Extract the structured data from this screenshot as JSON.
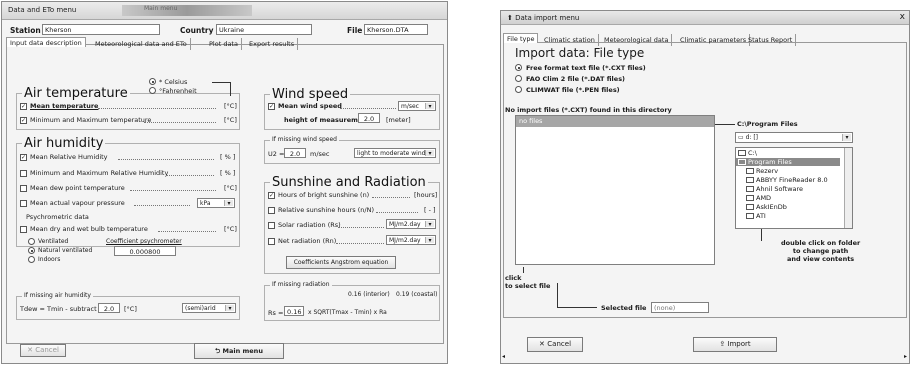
{
  "left": {
    "title": "Data and ETo menu",
    "title_blurred": "Main menu",
    "station_label": "Station",
    "station_value": "Kherson",
    "country_label": "Country",
    "country_value": "Ukraine",
    "file_label": "File",
    "file_value": "Kherson.DTA",
    "tabs": [
      "Input data description",
      "Meteorological data and ETo",
      "Plot data",
      "Export results"
    ],
    "air_temp": {
      "title": "Air temperature",
      "celsius": "* Celsius",
      "fahrenheit": "°Fahrenheit",
      "mean": "Mean temperature",
      "mean_unit": "[°C]",
      "minmax": "Minimum and Maximum temperature",
      "minmax_unit": "[°C]"
    },
    "humidity": {
      "title": "Air humidity",
      "mean_rh": "Mean Relative Humidity",
      "mean_rh_unit": "[ % ]",
      "minmax_rh": "Minimum and Maximum Relative Humidity",
      "minmax_rh_unit": "[ % ]",
      "dew": "Mean dew point temperature",
      "dew_unit": "[°C]",
      "vapour": "Mean actual vapour pressure",
      "vapour_unit": "kPa",
      "psychro_title": "Psychrometric data",
      "drywet": "Mean dry and wet bulb temperature",
      "drywet_unit": "[°C]",
      "ventilated": "Ventilated",
      "natural": "Natural ventilated",
      "indoors": "Indoors",
      "coef_label": "Coefficient psychrometer",
      "coef_value": "0.000800",
      "missing_title": "If missing air humidity",
      "tdew_label": "Tdew = Tmin - subtract",
      "tdew_value": "2.0",
      "tdew_unit": "[°C]",
      "climate_value": "(semi)arid"
    },
    "wind": {
      "title": "Wind speed",
      "mean_wind": "Mean wind speed",
      "unit": "m/sec",
      "height_label": "height of measurement",
      "height_value": "2.0",
      "height_unit": "[meter]",
      "missing_title": "If missing wind speed",
      "u2_label": "U2 =",
      "u2_value": "2.0",
      "u2_unit": "m/sec",
      "u2_select": "light to moderate wind"
    },
    "sunshine": {
      "title": "Sunshine and Radiation",
      "hours": "Hours of bright sunshine (n)",
      "hours_unit": "[hours]",
      "relative": "Relative sunshine hours (n/N)",
      "relative_unit": "[ - ]",
      "solar": "Solar radiation (Rs)",
      "solar_unit": "MJ/m2.day",
      "net": "Net radiation (Rn)",
      "net_unit": "MJ/m2.day",
      "coef_button": "Coefficients Angstrom equation",
      "missing_title": "If missing radiation",
      "interior": "0.16 (interior)",
      "coastal": "0.19 (coastal)",
      "rs_label": "Rs =",
      "rs_value": "0.16",
      "rs_formula": "x SQRT(Tmax - Tmin) x Ra"
    },
    "cancel": "Cancel",
    "main_menu": "Main menu"
  },
  "right": {
    "title": "Data import menu",
    "close": "x",
    "tabs": [
      "File type",
      "Climatic station",
      "Meteorological data",
      "Climatic parameters",
      "Status Report"
    ],
    "heading": "Import data:  File type",
    "opt1": "Free format text file (*.CXT files)",
    "opt2": "FAO Clim 2 file (*.DAT files)",
    "opt3": "CLIMWAT file (*.PEN files)",
    "no_files": "No import files (*.CXT) found in this directory",
    "list_selected": "no files",
    "path": "C:\\Program Files",
    "drive": "d: []",
    "folders": [
      "C:\\",
      "Program Files",
      "Rezerv",
      "ABBYY FineReader 8.0",
      "Ahnil Software",
      "AMD",
      "AskIEnDb",
      "ATI"
    ],
    "dbl_click": "double click on folder\nto change path\nand view contents",
    "click_note": "click\nto select file",
    "selected_label": "Selected file",
    "selected_value": "(none)",
    "cancel": "Cancel",
    "import": "Import"
  }
}
